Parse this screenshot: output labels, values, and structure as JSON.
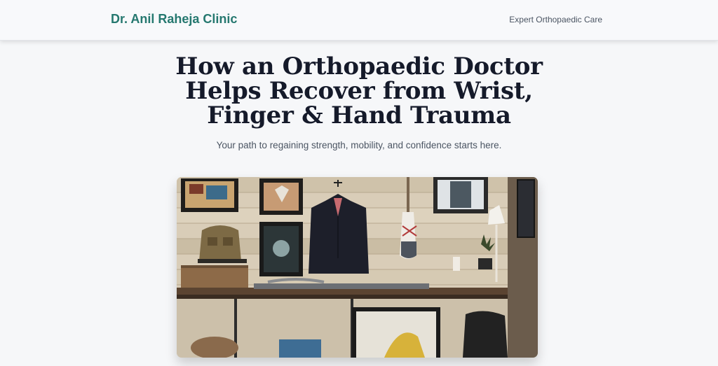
{
  "header": {
    "logo": "Dr. Anil Raheja Clinic",
    "tagline": "Expert Orthopaedic Care"
  },
  "hero": {
    "title": "How an Orthopaedic Doctor Helps Recover from Wrist, Finger & Hand Trauma",
    "subtitle": "Your path to regaining strength, mobility, and confidence starts here."
  },
  "colors": {
    "brand": "#25786f",
    "heading": "#151a2a",
    "background": "#f6f7f9"
  }
}
